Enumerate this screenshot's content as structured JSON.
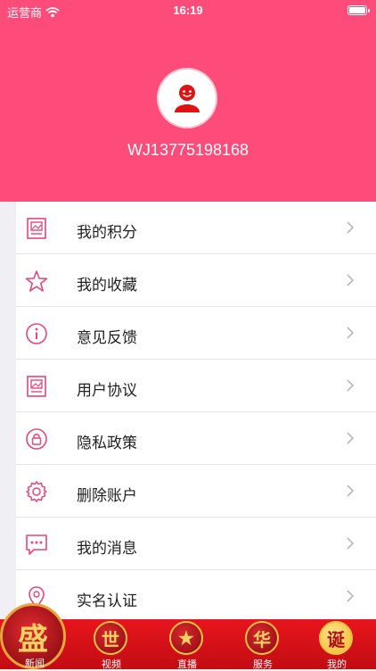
{
  "status_bar": {
    "carrier": "运营商",
    "time": "16:19"
  },
  "profile": {
    "username": "WJ13775198168"
  },
  "menu": [
    {
      "label": "我的积分",
      "icon": "document-icon"
    },
    {
      "label": "我的收藏",
      "icon": "star-icon"
    },
    {
      "label": "意见反馈",
      "icon": "info-icon"
    },
    {
      "label": "用户协议",
      "icon": "document-icon"
    },
    {
      "label": "隐私政策",
      "icon": "lock-icon"
    },
    {
      "label": "删除账户",
      "icon": "gear-icon"
    },
    {
      "label": "我的消息",
      "icon": "message-icon"
    },
    {
      "label": "实名认证",
      "icon": "location-icon"
    }
  ],
  "tabs": [
    {
      "label": "新闻",
      "glyph": "盛"
    },
    {
      "label": "视频",
      "glyph": "世"
    },
    {
      "label": "直播",
      "glyph": "★"
    },
    {
      "label": "服务",
      "glyph": "华"
    },
    {
      "label": "我的",
      "glyph": "诞"
    }
  ],
  "colors": {
    "accent": "#fe4c7a",
    "tabbar": "#d9121a",
    "icon": "#e8457a"
  }
}
